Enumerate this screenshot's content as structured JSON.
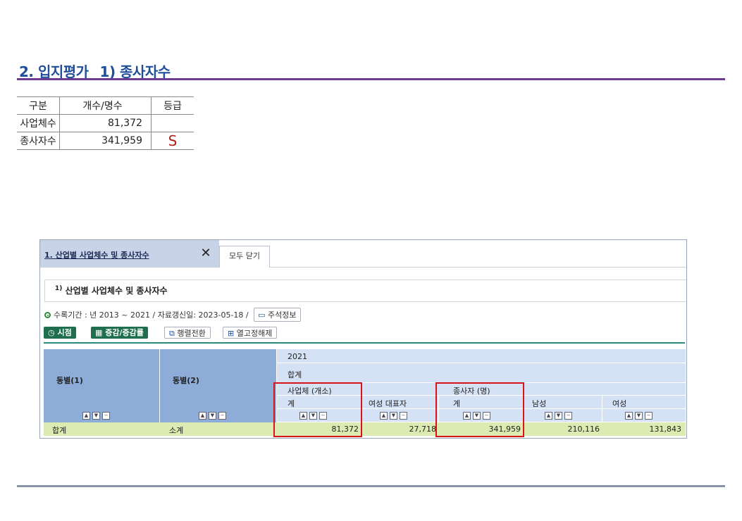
{
  "heading": "2. 입지평가_ 1) 종사자수",
  "summary_table": {
    "headers": [
      "구분",
      "개수/명수",
      "등급"
    ],
    "rows": [
      {
        "label": "사업체수",
        "value": "81,372",
        "grade": ""
      },
      {
        "label": "종사자수",
        "value": "341,959",
        "grade": "S"
      }
    ]
  },
  "panel": {
    "tab_active": "1. 산업별 사업체수 및 종사자수",
    "tab_close_icon": "close-icon",
    "tab_close_all": "모두 닫기",
    "stat_sup": "1)",
    "stat_title": "산업별 사업체수 및 종사자수",
    "meta_text": "수록기간 : 년 2013 ~ 2021 / 자료갱신일: 2023-05-18 /",
    "note_button": "주석정보",
    "toolbar": {
      "time_button": "시점",
      "change_button": "증감/증감률",
      "pivot_button": "행렬전환",
      "unfix_button": "열고정해제"
    },
    "grid": {
      "col_dong1": "동별(1)",
      "col_dong2": "동별(2)",
      "year": "2021",
      "total_header": "합계",
      "group_business": "사업체 (개소)",
      "group_workers": "종사자 (명)",
      "sub_total": "계",
      "sub_female_ceo": "여성 대표자",
      "sub_workers_total": "계",
      "sub_male": "남성",
      "sub_female": "여성",
      "row": {
        "dong1": "합계",
        "dong2": "소계",
        "business_total": "81,372",
        "female_ceo": "27,718",
        "workers_total": "341,959",
        "male": "210,116",
        "female": "131,843"
      }
    }
  }
}
